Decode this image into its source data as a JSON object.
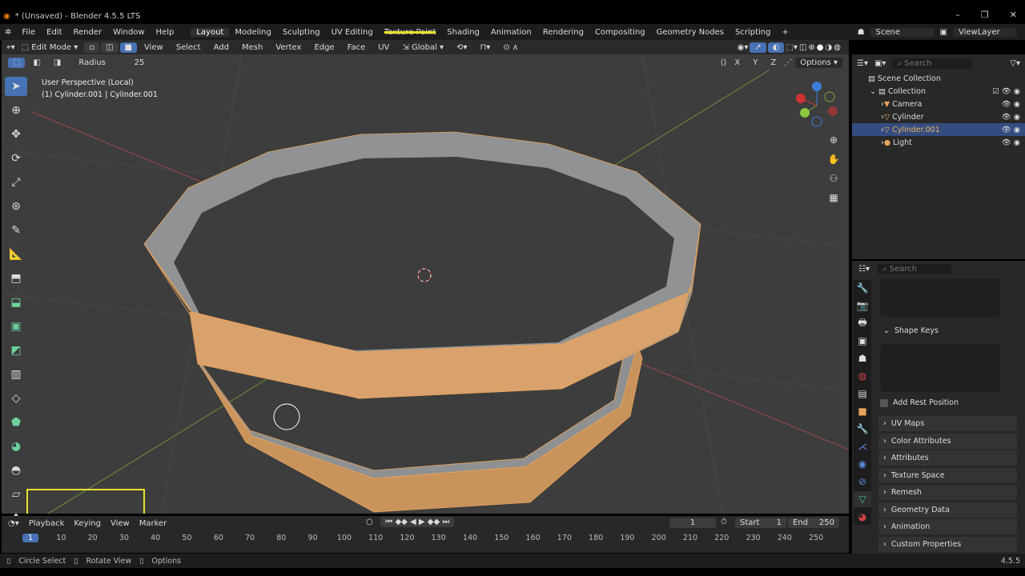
{
  "window": {
    "title": "* (Unsaved) - Blender 4.5.5 LTS",
    "minimize": "–",
    "maximize": "❐",
    "close": "✕"
  },
  "menu": [
    "File",
    "Edit",
    "Render",
    "Window",
    "Help"
  ],
  "workspaces": [
    "Layout",
    "Modeling",
    "Sculpting",
    "UV Editing",
    "Texture Paint",
    "Shading",
    "Animation",
    "Rendering",
    "Compositing",
    "Geometry Nodes",
    "Scripting",
    "+"
  ],
  "scene": {
    "name": "Scene",
    "view_layer": "ViewLayer"
  },
  "header": {
    "mode": "Edit Mode",
    "menus": [
      "View",
      "Select",
      "Add",
      "Mesh",
      "Vertex",
      "Edge",
      "Face",
      "UV"
    ],
    "orientation": "Global",
    "options": "Options",
    "axes": [
      "X",
      "Y",
      "Z"
    ]
  },
  "tool_settings": {
    "radius_label": "Radius",
    "radius_value": "25"
  },
  "viewport": {
    "perspective": "User Perspective (Local)",
    "object": "(1) Cylinder.001 | Cylinder.001"
  },
  "outliner": {
    "search_placeholder": "Search",
    "root": "Scene Collection",
    "collection": "Collection",
    "items": [
      {
        "name": "Camera",
        "color": "#5bbf9a"
      },
      {
        "name": "Cylinder",
        "color": "#5bbf9a"
      },
      {
        "name": "Cylinder.001",
        "color": "#5bbf9a",
        "selected": true
      },
      {
        "name": "Light",
        "color": "#5bbf9a"
      }
    ]
  },
  "properties": {
    "search_placeholder": "Search",
    "shape_keys": "Shape Keys",
    "add_rest_position": "Add Rest Position",
    "panels": [
      "UV Maps",
      "Color Attributes",
      "Attributes",
      "Texture Space",
      "Remesh",
      "Geometry Data",
      "Animation",
      "Custom Properties"
    ]
  },
  "timeline": {
    "menus": [
      "Playback",
      "Keying",
      "View",
      "Marker"
    ],
    "current_frame": "1",
    "start_label": "Start",
    "start": "1",
    "end_label": "End",
    "end": "250",
    "ticks": [
      "1",
      "10",
      "20",
      "30",
      "40",
      "50",
      "60",
      "70",
      "80",
      "90",
      "100",
      "110",
      "120",
      "130",
      "140",
      "150",
      "160",
      "170",
      "180",
      "190",
      "200",
      "210",
      "220",
      "230",
      "240",
      "250"
    ]
  },
  "status": {
    "items": [
      "Circle Select",
      "Rotate View",
      "Options"
    ],
    "version": "4.5.5"
  },
  "colors": {
    "accent": "#4772b3",
    "selection": "#e8a45c",
    "x_axis": "#c0504d",
    "y_axis": "#7aa33b"
  }
}
